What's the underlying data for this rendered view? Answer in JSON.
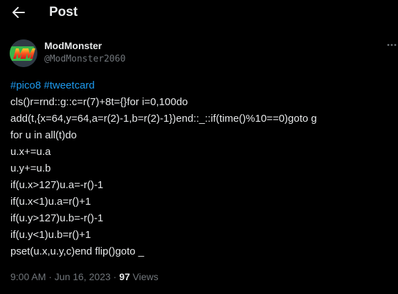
{
  "header": {
    "back_icon": "arrow-left-icon",
    "title": "Post"
  },
  "author": {
    "avatar_text": "MM",
    "display_name": "ModMonster",
    "handle": "@ModMonster2060"
  },
  "more_icon": "more-dots-icon",
  "tweet": {
    "hashtags": [
      "#pico8",
      "#tweetcard"
    ],
    "code_lines": [
      "cls()r=rnd::g::c=r(7)+8t={}for i=0,100do",
      "add(t,{x=64,y=64,a=r(2)-1,b=r(2)-1})end::_::if(time()%10==0)goto g",
      "for u in all(t)do",
      "u.x+=u.a",
      "u.y+=u.b",
      "if(u.x>127)u.a=-r()-1",
      "if(u.x<1)u.a=r()+1",
      "if(u.y>127)u.b=-r()-1",
      "if(u.y<1)u.b=r()+1",
      "pset(u.x,u.y,c)end flip()goto _"
    ]
  },
  "meta": {
    "timestamp": "9:00 AM · Jun 16, 2023 · ",
    "views_count": "97",
    "views_label": " Views"
  },
  "colors": {
    "background": "#000000",
    "text": "#e7e9ea",
    "secondary": "#71767b",
    "link": "#1d9bf0"
  }
}
